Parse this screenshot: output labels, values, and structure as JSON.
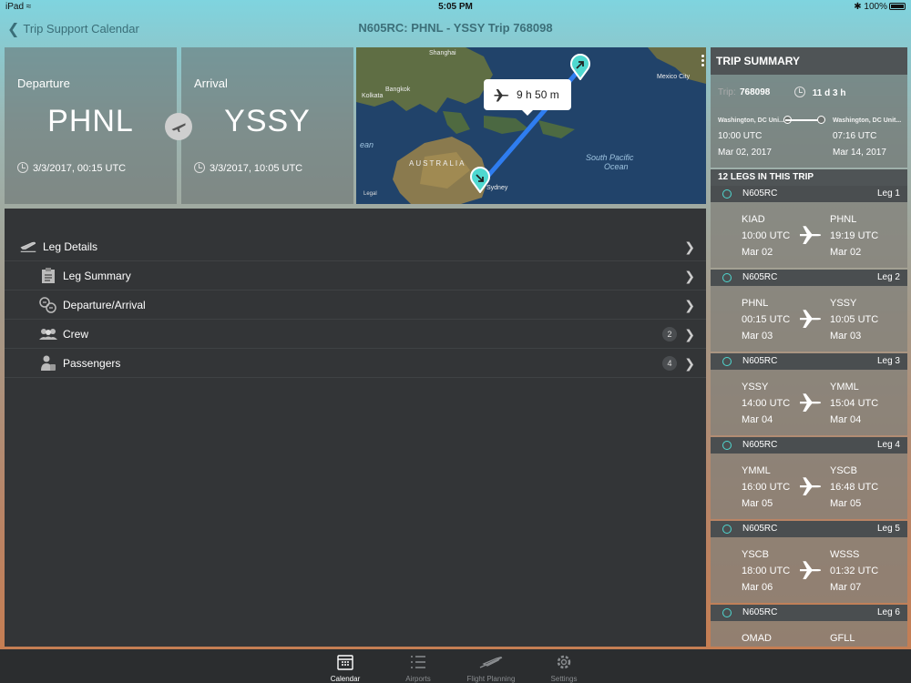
{
  "status": {
    "device": "iPad",
    "time": "5:05 PM",
    "battery": "100%"
  },
  "nav": {
    "back_label": "Trip Support Calendar",
    "title": "N605RC: PHNL - YSSY  Trip 768098"
  },
  "departure": {
    "label": "Departure",
    "code": "PHNL",
    "time": "3/3/2017, 00:15 UTC"
  },
  "arrival": {
    "label": "Arrival",
    "code": "YSSY",
    "time": "3/3/2017, 10:05 UTC"
  },
  "map": {
    "flight_time": "9 h 50 m",
    "legal": "Legal",
    "labels": [
      "Shanghai",
      "Kolkata",
      "Bangkok",
      "Mexico City",
      "AUSTRALIA",
      "Sydney",
      "South Pacific",
      "Ocean",
      "ean"
    ]
  },
  "details": {
    "rows": [
      {
        "label": "Leg Details",
        "icon": "plane-depart-icon"
      },
      {
        "label": "Leg Summary",
        "icon": "clipboard-icon"
      },
      {
        "label": "Departure/Arrival",
        "icon": "departure-arrival-icon"
      },
      {
        "label": "Crew",
        "icon": "crew-icon",
        "badge": "2"
      },
      {
        "label": "Passengers",
        "icon": "passengers-icon",
        "badge": "4"
      }
    ]
  },
  "summary": {
    "title": "TRIP SUMMARY",
    "trip_label": "Trip:",
    "trip_number": "768098",
    "duration": "11 d 3 h",
    "from_loc": "Washington, DC Uni...",
    "to_loc": "Washington, DC Unit...",
    "from_time": "10:00 UTC",
    "to_time": "07:16 UTC",
    "from_date": "Mar 02, 2017",
    "to_date": "Mar 14, 2017",
    "legs_title": "12 LEGS IN THIS TRIP"
  },
  "legs": [
    {
      "reg": "N605RC",
      "num": "Leg 1",
      "from": "KIAD",
      "dep_time": "10:00 UTC",
      "dep_date": "Mar 02",
      "to": "PHNL",
      "arr_time": "19:19 UTC",
      "arr_date": "Mar 02"
    },
    {
      "reg": "N605RC",
      "num": "Leg 2",
      "from": "PHNL",
      "dep_time": "00:15 UTC",
      "dep_date": "Mar 03",
      "to": "YSSY",
      "arr_time": "10:05 UTC",
      "arr_date": "Mar 03"
    },
    {
      "reg": "N605RC",
      "num": "Leg 3",
      "from": "YSSY",
      "dep_time": "14:00 UTC",
      "dep_date": "Mar 04",
      "to": "YMML",
      "arr_time": "15:04 UTC",
      "arr_date": "Mar 04"
    },
    {
      "reg": "N605RC",
      "num": "Leg 4",
      "from": "YMML",
      "dep_time": "16:00 UTC",
      "dep_date": "Mar 05",
      "to": "YSCB",
      "arr_time": "16:48 UTC",
      "arr_date": "Mar 05"
    },
    {
      "reg": "N605RC",
      "num": "Leg 5",
      "from": "YSCB",
      "dep_time": "18:00 UTC",
      "dep_date": "Mar 06",
      "to": "WSSS",
      "arr_time": "01:32 UTC",
      "arr_date": "Mar 07"
    },
    {
      "reg": "N605RC",
      "num": "Leg 6",
      "from": "OMAD",
      "dep_time": "",
      "dep_date": "",
      "to": "GFLL",
      "arr_time": "",
      "arr_date": ""
    }
  ],
  "tabs": [
    {
      "label": "Calendar",
      "icon": "calendar-icon"
    },
    {
      "label": "Airports",
      "icon": "list-icon"
    },
    {
      "label": "Flight Planning",
      "icon": "airplane-icon"
    },
    {
      "label": "Settings",
      "icon": "gear-icon"
    }
  ],
  "colors": {
    "accent_teal": "#4fd8d0",
    "route_blue": "#2f7df0",
    "panel_bg": "#333537",
    "tabbar_bg": "#2b2d2f"
  }
}
